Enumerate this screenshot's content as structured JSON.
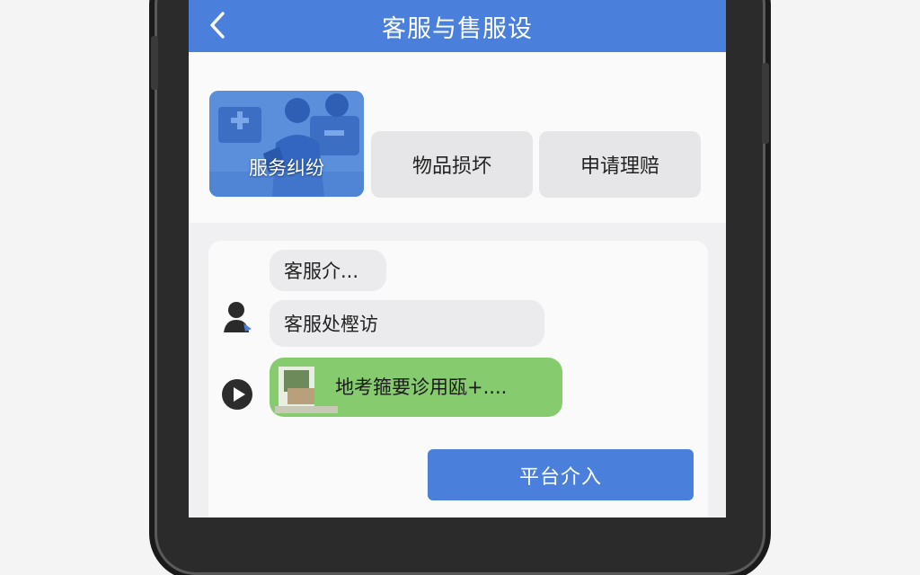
{
  "header": {
    "title": "客服与售服设",
    "back_icon": "chevron-left-icon"
  },
  "categories": [
    {
      "label": "服务纠纷",
      "selected": true
    },
    {
      "label": "物品损坏",
      "selected": false
    },
    {
      "label": "申请理赔",
      "selected": false
    }
  ],
  "chat": {
    "messages": [
      {
        "text": "客服介..."
      },
      {
        "text": "客服处樫访"
      },
      {
        "text": "地考箍要诊用瓯+...."
      }
    ],
    "avatar_icon": "customer-service-avatar-icon",
    "play_icon": "play-icon"
  },
  "actions": {
    "intervene_label": "平台介入"
  },
  "colors": {
    "accent": "#4a80dc",
    "green_bubble": "#86cc6e"
  }
}
